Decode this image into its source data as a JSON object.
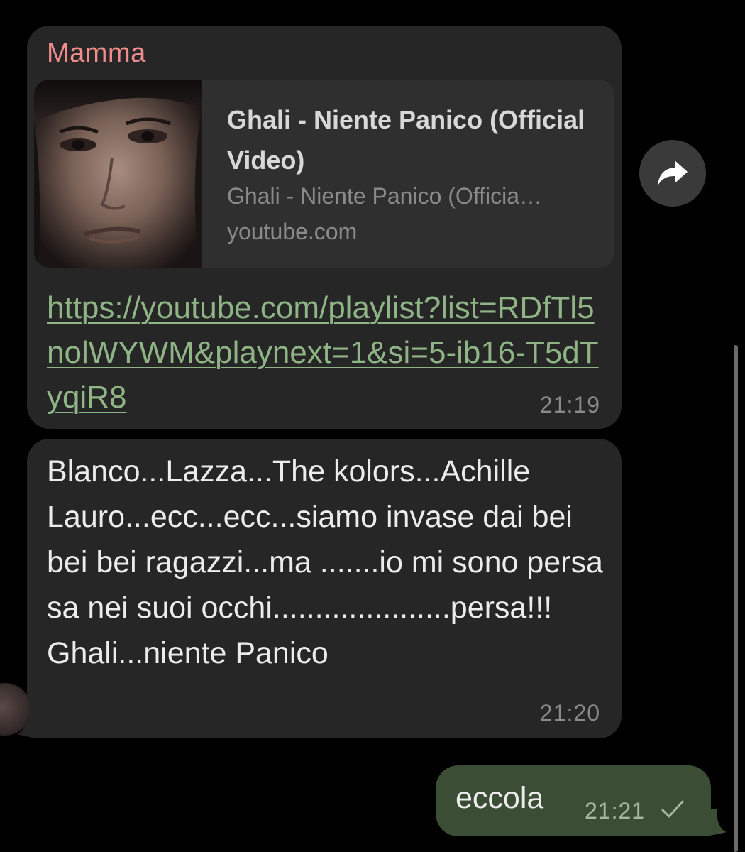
{
  "messages": {
    "first": {
      "sender": "Mamma",
      "preview": {
        "title": "Ghali - Niente Panico (Official Video)",
        "description": "Ghali - Niente Panico (Officia…",
        "domain": "youtube.com"
      },
      "link": "https://youtube.com/playlist?list=RDfTl5nolWYWM&playnext=1&si=5-ib16-T5dTyqiR8",
      "time": "21:19"
    },
    "second": {
      "text": "Blanco...Lazza...The kolors...Achille Lauro...ecc...ecc...siamo invase dai bei bei bei ragazzi...ma .......io mi sono persa sa nei suoi occhi.....................persa!!!\nGhali...niente Panico",
      "time": "21:20"
    },
    "outgoing": {
      "text": "eccola",
      "time": "21:21",
      "status_icon": "check-icon"
    }
  },
  "icons": {
    "forward": "forward-arrow-icon"
  },
  "colors": {
    "background": "#000000",
    "incoming_bubble": "#262626",
    "outgoing_bubble": "#3b4d35",
    "sender_name": "#f08c8c",
    "link": "#8fb486",
    "timestamp": "#8a8a8a"
  }
}
